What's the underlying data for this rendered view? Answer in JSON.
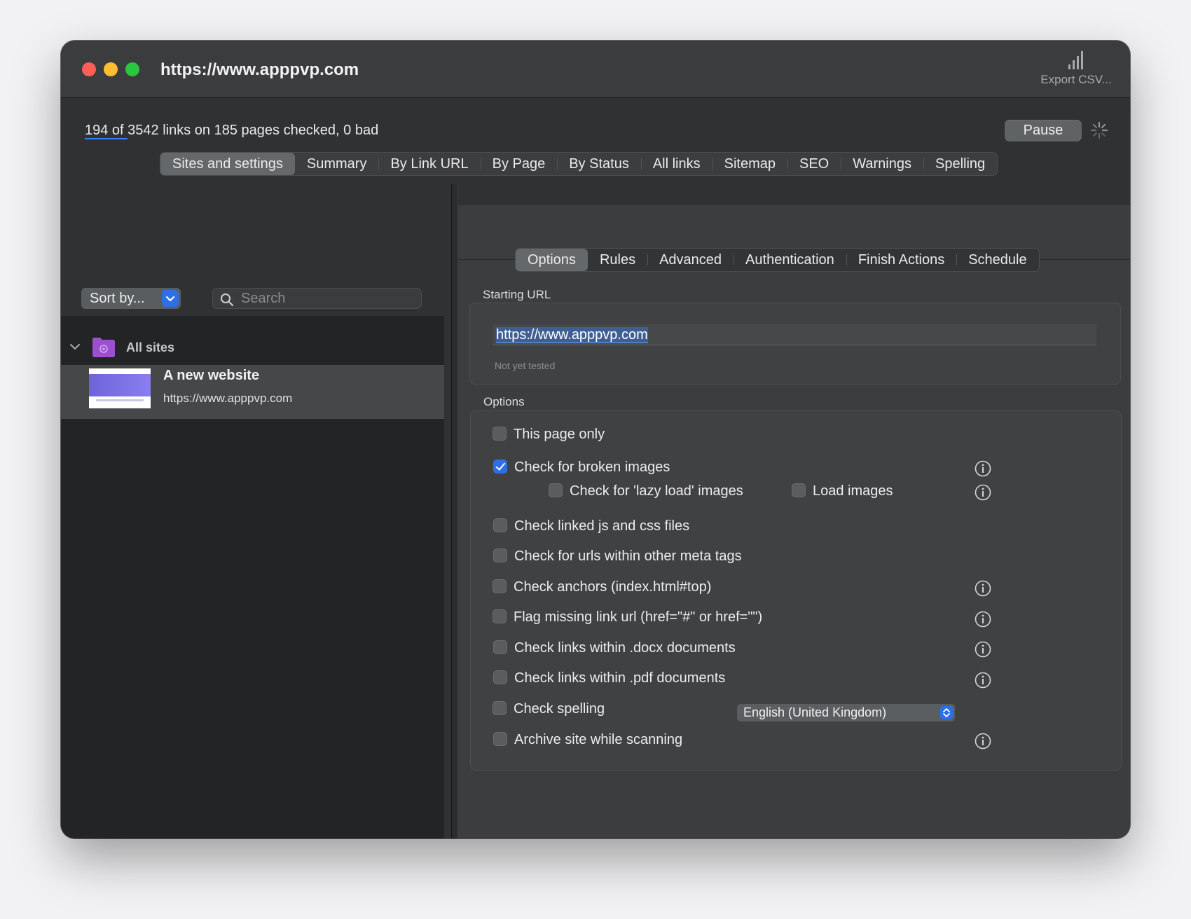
{
  "window": {
    "title": "https://www.apppvp.com",
    "export_label": "Export CSV..."
  },
  "status": {
    "progress_underlined": "194 of ",
    "progress_rest": "3542 links on 185 pages checked, 0 bad",
    "pause_label": "Pause"
  },
  "main_tabs": [
    "Sites and settings",
    "Summary",
    "By Link URL",
    "By Page",
    "By Status",
    "All links",
    "Sitemap",
    "SEO",
    "Warnings",
    "Spelling"
  ],
  "sidebar": {
    "sort_label": "Sort by...",
    "search_placeholder": "Search",
    "group_name": "All sites",
    "site_name": "A new website",
    "site_url": "https://www.apppvp.com"
  },
  "sub_tabs": [
    "Options",
    "Rules",
    "Advanced",
    "Authentication",
    "Finish Actions",
    "Schedule"
  ],
  "starting_url": {
    "label": "Starting URL",
    "value": "https://www.apppvp.com",
    "status": "Not yet tested"
  },
  "options": {
    "label": "Options",
    "this_page_only": "This page only",
    "broken_images": "Check for broken images",
    "lazy_load": "Check for 'lazy load' images",
    "load_images": "Load images",
    "js_css": "Check linked js and css files",
    "meta_tags": "Check for urls within other meta tags",
    "anchors": "Check anchors (index.html#top)",
    "missing_href": "Flag missing link url (href=\"#\" or href=\"\")",
    "docx": "Check links within .docx documents",
    "pdf": "Check links within .pdf documents",
    "spelling": "Check spelling",
    "spelling_language": "English (United Kingdom)",
    "archive": "Archive site while scanning"
  },
  "colors": {
    "accent": "#2f6fe6",
    "close": "#ff5f57",
    "minimize": "#febc2e",
    "zoom": "#28c840"
  }
}
